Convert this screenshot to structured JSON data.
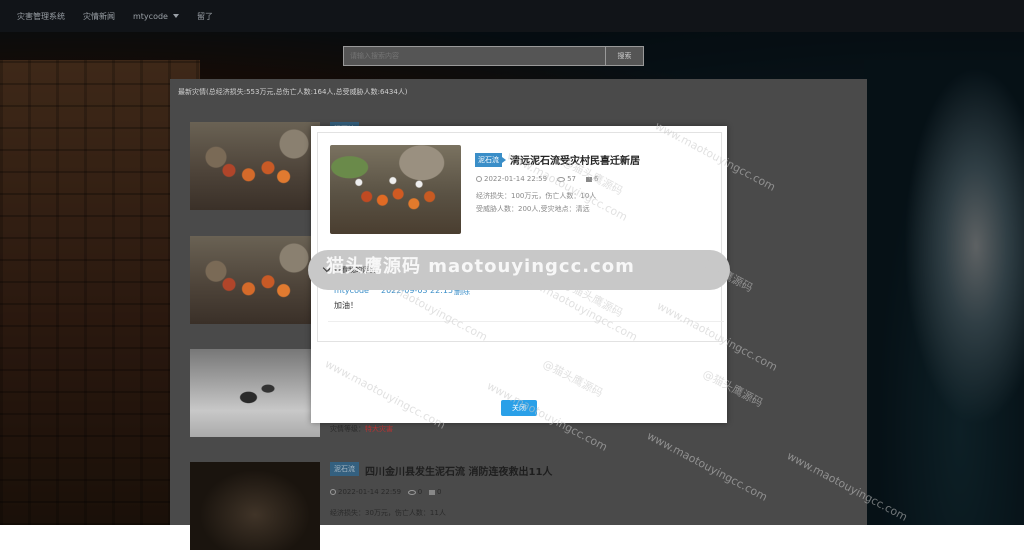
{
  "navbar": {
    "items": [
      "灾害管理系统",
      "灾情新闻",
      "mtycode",
      "留了"
    ]
  },
  "search": {
    "placeholder": "请输入搜索内容",
    "button_label": "搜索"
  },
  "summary_text": "最新灾情(总经济损失:553万元,总伤亡人数:164人,总受威胁人数:6434人)",
  "background_cards": [
    {
      "tag": "泥石流",
      "title": "",
      "meta": "",
      "line1": "",
      "line2": ""
    },
    {
      "tag": "",
      "title": "",
      "meta": "",
      "line1": "",
      "line2": ""
    },
    {
      "tag": "",
      "title": "",
      "meta": "",
      "line1": "灾情等级：",
      "line1_value": "特大灾害"
    },
    {
      "tag": "泥石流",
      "title": "四川金川县发生泥石流 消防连夜救出11人",
      "meta_time": "2022-01-14 22:59",
      "meta_views": "0",
      "meta_comments": "0",
      "line1": "经济损失：30万元，伤亡人数：11人"
    }
  ],
  "modal": {
    "tag": "泥石流",
    "title": "清远泥石流受灾村民喜迁新居",
    "time": "2022-01-14 22:59",
    "views": "57",
    "comments": "6",
    "line1": "经济损失：100万元，伤亡人数：10人",
    "line2": "受威胁人数：200人,受灾地点：清远",
    "accordion_label": "查看我的评价",
    "comment": {
      "user": "mtycode",
      "time": "2022-09-03 22:15",
      "delete_label": "删除",
      "text": "加油！"
    },
    "close_label": "关闭"
  },
  "watermark": {
    "banner": "猫头鹰源码 maotouyingcc.com",
    "url": "www.maotouyingcc.com",
    "cn": "@猫头鹰源码"
  }
}
